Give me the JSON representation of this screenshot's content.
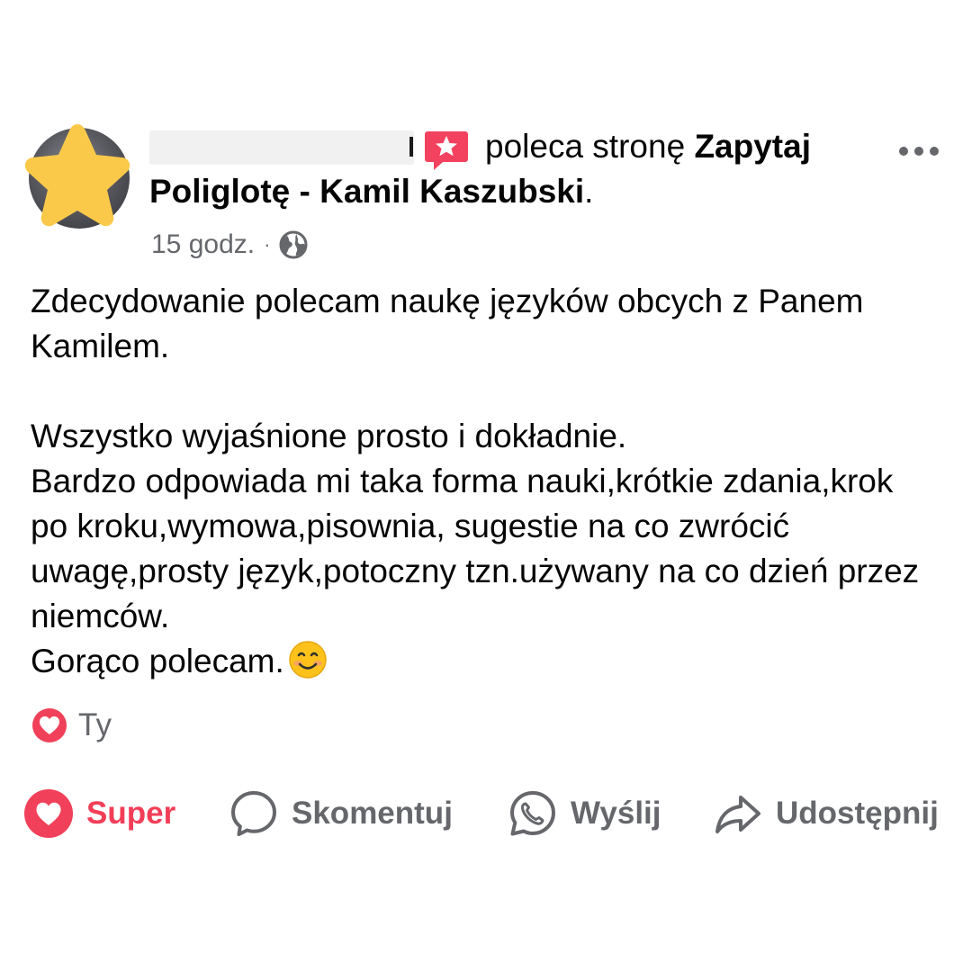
{
  "post": {
    "headline": {
      "action_text": "poleca stronę",
      "page_name": "Zapytaj Poliglotę - Kamil Kaszubski",
      "end_punct": "."
    },
    "meta": {
      "time": "15 godz.",
      "separator": "·"
    },
    "body": {
      "paragraph1": "Zdecydowanie polecam naukę języków obcych z Panem Kamilem.",
      "line1": "Wszystko wyjaśnione prosto i dokładnie.",
      "line2": "Bardzo odpowiada mi taka forma nauki,krótkie zdania,krok po kroku,wymowa,pisownia, sugestie na co zwrócić uwagę,prosty język,potoczny tzn.używany na co dzień przez niemców.",
      "line3": "Gorąco polecam."
    },
    "reactions": {
      "label": "Ty"
    },
    "actions": {
      "like": "Super",
      "comment": "Skomentuj",
      "send": "Wyślij",
      "share": "Udostępnij"
    }
  },
  "colors": {
    "reaction_red": "#f33e58",
    "secondary_text": "#65676b",
    "avatar_star": "#fbc94a"
  },
  "icons": [
    "star-icon",
    "recommend-icon",
    "more-options-icon",
    "globe-icon",
    "smiling-emoji-icon",
    "heart-reaction-icon",
    "comment-icon",
    "messenger-icon",
    "share-icon"
  ]
}
